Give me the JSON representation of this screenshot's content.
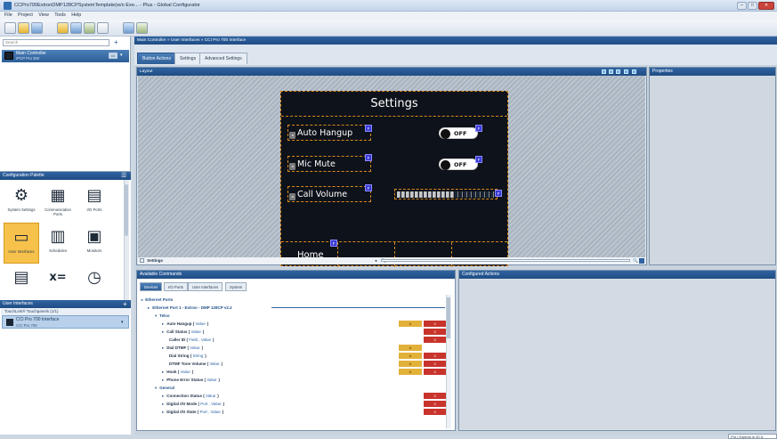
{
  "window": {
    "title": "CCPro700ExtronDMP128CPSystemTemplate(w/o Exe... - Plus - Global Configurator",
    "minimize": "‒",
    "maximize": "□",
    "close": "✕"
  },
  "menu": [
    "File",
    "Project",
    "View",
    "Tools",
    "Help"
  ],
  "left": {
    "search_placeholder": "Search",
    "add_label": "+",
    "controller": {
      "name": "Main Controller",
      "model": "IPCP Pro 350"
    },
    "palette": {
      "title": "Configuration Palette",
      "items": [
        {
          "label": "System Settings",
          "icon": "gears-icon",
          "glyph": "⚙"
        },
        {
          "label": "Communication Ports",
          "icon": "communication-ports-icon",
          "glyph": "▦"
        },
        {
          "label": "I/O Ports",
          "icon": "io-ports-icon",
          "glyph": "▤"
        },
        {
          "label": "User Interfaces",
          "icon": "user-interfaces-icon",
          "glyph": "▭"
        },
        {
          "label": "Schedules",
          "icon": "calendar-icon",
          "glyph": "▥"
        },
        {
          "label": "Monitors",
          "icon": "monitors-icon",
          "glyph": "▣"
        },
        {
          "label": "",
          "icon": "document-icon",
          "glyph": "▤"
        },
        {
          "label": "",
          "icon": "variables-icon",
          "glyph": "x="
        },
        {
          "label": "",
          "icon": "timer-icon",
          "glyph": "◷"
        }
      ]
    },
    "ui_panel": {
      "title": "User Interfaces",
      "add_label": "+",
      "tree_label": "TouchLink® Touchpanels (1/1)",
      "selected": {
        "name": "CCI Pro 700 Interface",
        "model": "CCI Pro 700"
      }
    }
  },
  "main": {
    "breadcrumb": "Main Controller » User Interfaces » CCI Pro 700 Interface",
    "tabs": [
      "Button Actions",
      "Settings",
      "Advanced Settings"
    ],
    "active_tab": 0,
    "layout_title": "Layout",
    "properties_title": "Properties",
    "panel": {
      "title": "Settings",
      "rows": [
        {
          "label": "Auto Hangup",
          "control": "OFF"
        },
        {
          "label": "Mic Mute",
          "control": "OFF"
        },
        {
          "label": "Call Volume",
          "control": ""
        }
      ],
      "badge": "F",
      "home": "Home",
      "slider_level": 0.55
    },
    "page_select": "Settings",
    "zoom_icon": "🔍"
  },
  "commands": {
    "title": "Available Commands",
    "tabs": [
      "Devices",
      "I/O Ports",
      "User Interfaces",
      "System"
    ],
    "active_tab": 0,
    "rows": [
      {
        "indent": 0,
        "arrow": "◂",
        "text": "Ethernet Ports",
        "param": "",
        "param_suffix": "",
        "a": "",
        "r": ""
      },
      {
        "indent": 1,
        "arrow": "▸",
        "text": "Ethernet Port 1 - Extron - DMP 128CP v2.2",
        "param": "",
        "param_suffix": "",
        "a": "",
        "r": ""
      },
      {
        "indent": 2,
        "arrow": "▾",
        "text": "Telco",
        "param": "",
        "param_suffix": "",
        "a": "",
        "r": ""
      },
      {
        "indent": 3,
        "arrow": "▸",
        "text": "Auto Hangup (",
        "param": "Value",
        "param_suffix": ")",
        "a": "A",
        "r": "C"
      },
      {
        "indent": 3,
        "arrow": "▸",
        "text": "Call Status (",
        "param": "Value",
        "param_suffix": ")",
        "a": "",
        "r": "C"
      },
      {
        "indent": 3,
        "arrow": "",
        "text": "Caller ID (",
        "param": "Field , Value",
        "param_suffix": ")",
        "a": "",
        "r": "C"
      },
      {
        "indent": 3,
        "arrow": "▸",
        "text": "Dial DTMF (",
        "param": "Value",
        "param_suffix": ")",
        "a": "A",
        "r": ""
      },
      {
        "indent": 3,
        "arrow": "",
        "text": "Dial String (",
        "param": "String",
        "param_suffix": ")",
        "a": "A",
        "r": "C"
      },
      {
        "indent": 3,
        "arrow": "",
        "text": "DTMF Tone Volume (",
        "param": "Value",
        "param_suffix": ")",
        "a": "A",
        "r": "C"
      },
      {
        "indent": 3,
        "arrow": "▸",
        "text": "Hook (",
        "param": "Value",
        "param_suffix": ")",
        "a": "A",
        "r": "C"
      },
      {
        "indent": 3,
        "arrow": "▸",
        "text": "Phone Error Status (",
        "param": "Value",
        "param_suffix": ")",
        "a": "",
        "r": ""
      },
      {
        "indent": 2,
        "arrow": "▾",
        "text": "General",
        "param": "",
        "param_suffix": "",
        "a": "",
        "r": ""
      },
      {
        "indent": 3,
        "arrow": "▸",
        "text": "Connection Status (",
        "param": "Value",
        "param_suffix": ")",
        "a": "",
        "r": "C"
      },
      {
        "indent": 3,
        "arrow": "▸",
        "text": "Digital I/O Mode (",
        "param": "Port , Value",
        "param_suffix": ")",
        "a": "",
        "r": "C"
      },
      {
        "indent": 3,
        "arrow": "▸",
        "text": "Digital I/O State (",
        "param": "Port , Value",
        "param_suffix": ")",
        "a": "",
        "r": "C"
      }
    ]
  },
  "configured": {
    "title": "Configured Actions"
  },
  "status": {
    "license": "Pro | Expires in 30 d"
  },
  "colors": {
    "accent": "#2f63a1",
    "action_badge": "#e3b13a",
    "condition_badge": "#c8332c",
    "dash": "#d98a1c"
  }
}
